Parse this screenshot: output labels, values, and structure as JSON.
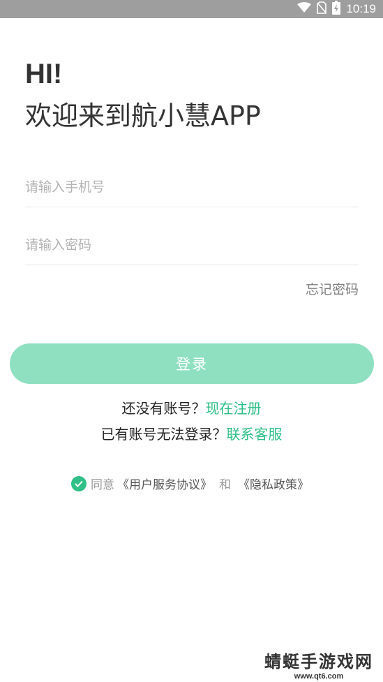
{
  "status_bar": {
    "time": "10:19"
  },
  "greeting": {
    "line1": "HI!",
    "line2": "欢迎来到航小慧APP"
  },
  "form": {
    "phone_placeholder": "请输入手机号",
    "password_placeholder": "请输入密码",
    "forgot_label": "忘记密码",
    "login_label": "登录"
  },
  "register": {
    "prompt": "还没有账号？",
    "link": "现在注册"
  },
  "support": {
    "prompt": "已有账号无法登录？",
    "link": "联系客服"
  },
  "agreement": {
    "prefix": "同意",
    "user_agreement": "《用户服务协议》",
    "conjunction": "和",
    "privacy_policy": "《隐私政策》"
  },
  "watermark": {
    "title": "蜻蜓手游戏网",
    "url": "www.qt6.com"
  },
  "colors": {
    "accent": "#2fbf87",
    "button_disabled": "#8ee0c1",
    "status_bar": "#9e9e9e",
    "text_primary": "#333333",
    "placeholder": "#b3b3b3"
  }
}
